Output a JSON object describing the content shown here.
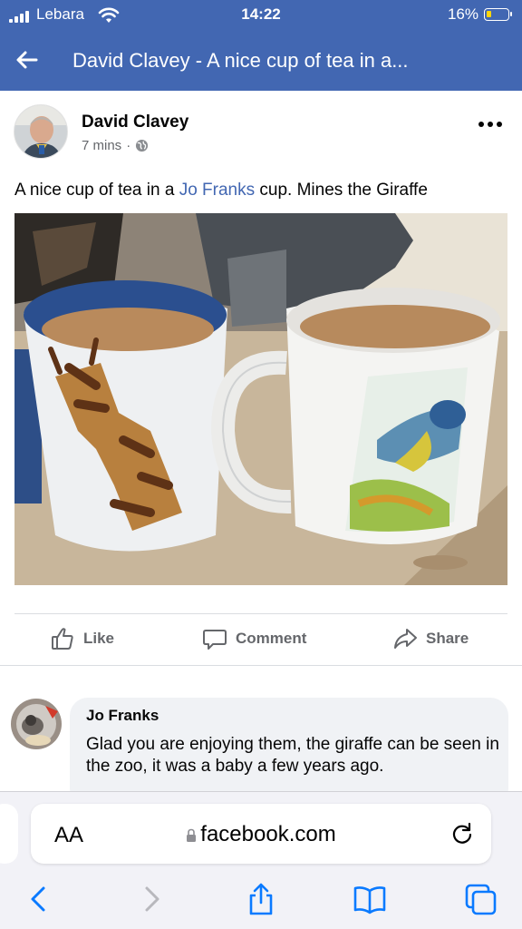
{
  "status": {
    "carrier": "Lebara",
    "time": "14:22",
    "battery": "16%"
  },
  "header": {
    "title": "David Clavey - A nice cup of tea in a..."
  },
  "post": {
    "author": "David Clavey",
    "time": "7 mins",
    "separator": "·",
    "text_before": "A nice cup of tea in a ",
    "text_link": "Jo Franks",
    "text_after": " cup. Mines the Giraffe"
  },
  "actions": {
    "like": "Like",
    "comment": "Comment",
    "share": "Share"
  },
  "comment": {
    "author": "Jo Franks",
    "text": "Glad you are enjoying them, the giraffe can be seen in the zoo, it was a baby a few years ago."
  },
  "browser": {
    "text_size_label": "AA",
    "url": "facebook.com"
  },
  "colors": {
    "brand": "#4267b2",
    "link": "#4267b2",
    "secondary_text": "#65676b",
    "ios_blue": "#0a7aff"
  }
}
